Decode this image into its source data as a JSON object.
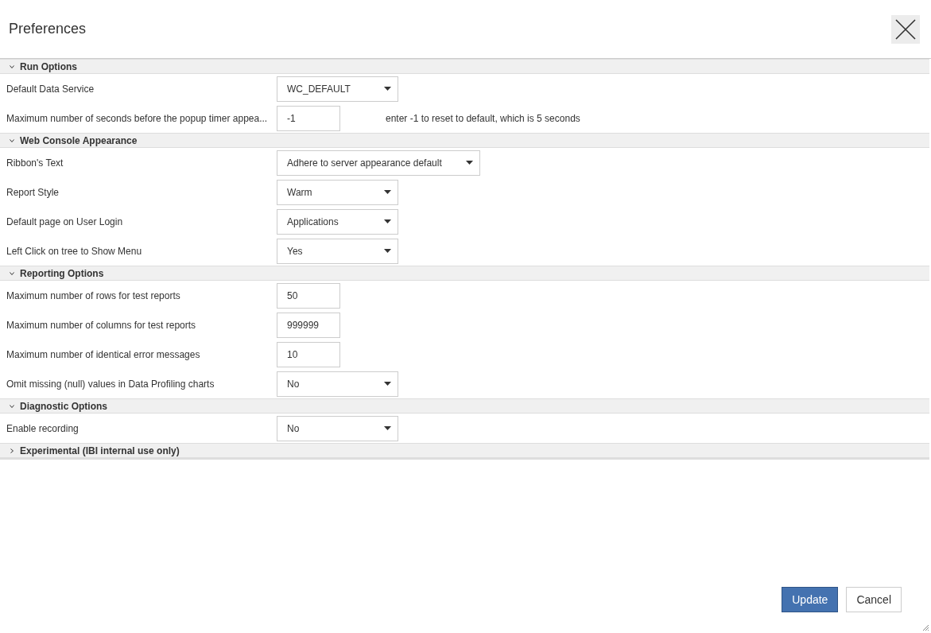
{
  "window": {
    "title": "Preferences"
  },
  "sections": [
    {
      "title": "Run Options",
      "expanded": true,
      "rows": [
        {
          "kind": "select",
          "label": "Default Data Service",
          "value": "WC_DEFAULT"
        },
        {
          "kind": "text",
          "label": "Maximum number of seconds before the popup timer appea...",
          "value": "-1",
          "hint": "enter -1 to reset to default, which is 5 seconds"
        }
      ]
    },
    {
      "title": "Web Console Appearance",
      "expanded": true,
      "rows": [
        {
          "kind": "select",
          "label": "Ribbon's Text",
          "value": "Adhere to server appearance default"
        },
        {
          "kind": "select",
          "label": "Report Style",
          "value": "Warm"
        },
        {
          "kind": "select",
          "label": "Default page on User Login",
          "value": "Applications"
        },
        {
          "kind": "select",
          "label": "Left Click on tree to Show Menu",
          "value": "Yes"
        }
      ]
    },
    {
      "title": "Reporting Options",
      "expanded": true,
      "rows": [
        {
          "kind": "text",
          "label": "Maximum number of rows for test reports",
          "value": "50"
        },
        {
          "kind": "text",
          "label": "Maximum number of columns for test reports",
          "value": "999999"
        },
        {
          "kind": "text",
          "label": "Maximum number of identical error messages",
          "value": "10"
        },
        {
          "kind": "select",
          "label": "Omit missing (null) values in Data Profiling charts",
          "value": "No"
        }
      ]
    },
    {
      "title": "Diagnostic Options",
      "expanded": true,
      "rows": [
        {
          "kind": "select",
          "label": "Enable recording",
          "value": "No"
        }
      ]
    },
    {
      "title": "Experimental (IBI internal use only)",
      "expanded": false
    }
  ],
  "buttons": [
    {
      "label": "Update",
      "kind": "primary"
    },
    {
      "label": "Cancel",
      "kind": "secondary"
    }
  ]
}
